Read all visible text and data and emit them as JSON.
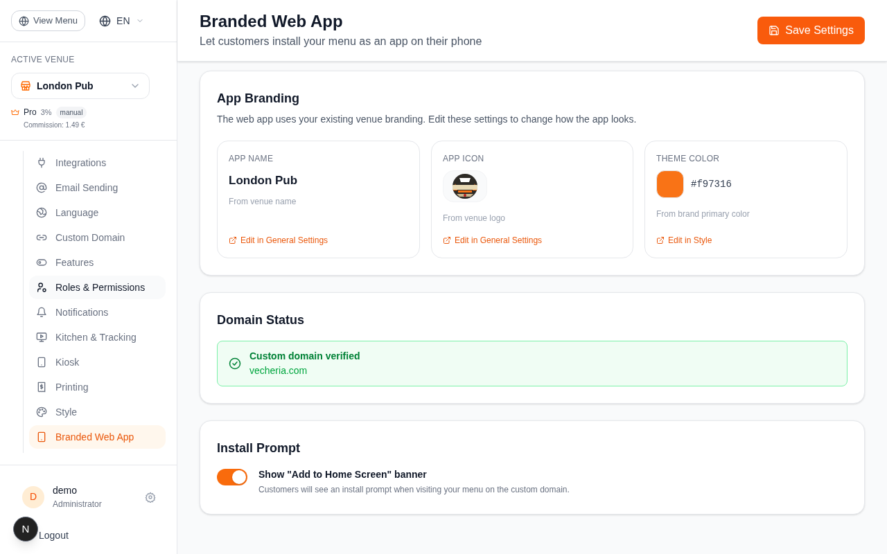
{
  "sidebar": {
    "view_menu": "View Menu",
    "language": "EN",
    "venue_label": "ACTIVE VENUE",
    "venue": "London Pub",
    "plan": "Pro",
    "plan_rate": "3%",
    "plan_badge": "manual",
    "commission": "Commission: 1.49 €",
    "nav": [
      {
        "label": "Integrations",
        "selected": false
      },
      {
        "label": "Email Sending",
        "selected": false
      },
      {
        "label": "Language",
        "selected": false
      },
      {
        "label": "Custom Domain",
        "selected": false
      },
      {
        "label": "Features",
        "selected": false
      },
      {
        "label": "Roles & Permissions",
        "selected": false,
        "hovered": true
      },
      {
        "label": "Notifications",
        "selected": false
      },
      {
        "label": "Kitchen & Tracking",
        "selected": false
      },
      {
        "label": "Kiosk",
        "selected": false
      },
      {
        "label": "Printing",
        "selected": false
      },
      {
        "label": "Style",
        "selected": false
      },
      {
        "label": "Branded Web App",
        "selected": true
      }
    ],
    "user": {
      "initial": "D",
      "name": "demo",
      "role": "Administrator"
    },
    "logout": "Logout",
    "dev_badge": "N"
  },
  "header": {
    "title": "Branded Web App",
    "subtitle": "Let customers install your menu as an app on their phone",
    "save": "Save Settings"
  },
  "branding": {
    "title": "App Branding",
    "description": "The web app uses your existing venue branding. Edit these settings to change how the app looks.",
    "cards": [
      {
        "kind": "text",
        "label": "APP NAME",
        "value": "London Pub",
        "note": "From venue name",
        "link": "Edit in General Settings"
      },
      {
        "kind": "icon",
        "label": "APP ICON",
        "note": "From venue logo",
        "link": "Edit in General Settings"
      },
      {
        "kind": "color",
        "label": "THEME COLOR",
        "value": "#f97316",
        "color": "#f97316",
        "note": "From brand primary color",
        "link": "Edit in Style"
      }
    ]
  },
  "domain": {
    "title": "Domain Status",
    "verified": true,
    "status": "Custom domain verified",
    "domain": "vecheria.com"
  },
  "install": {
    "title": "Install Prompt",
    "toggle": {
      "on": true,
      "label": "Show \"Add to Home Screen\" banner",
      "description": "Customers will see an install prompt when visiting your menu on the custom domain."
    }
  }
}
